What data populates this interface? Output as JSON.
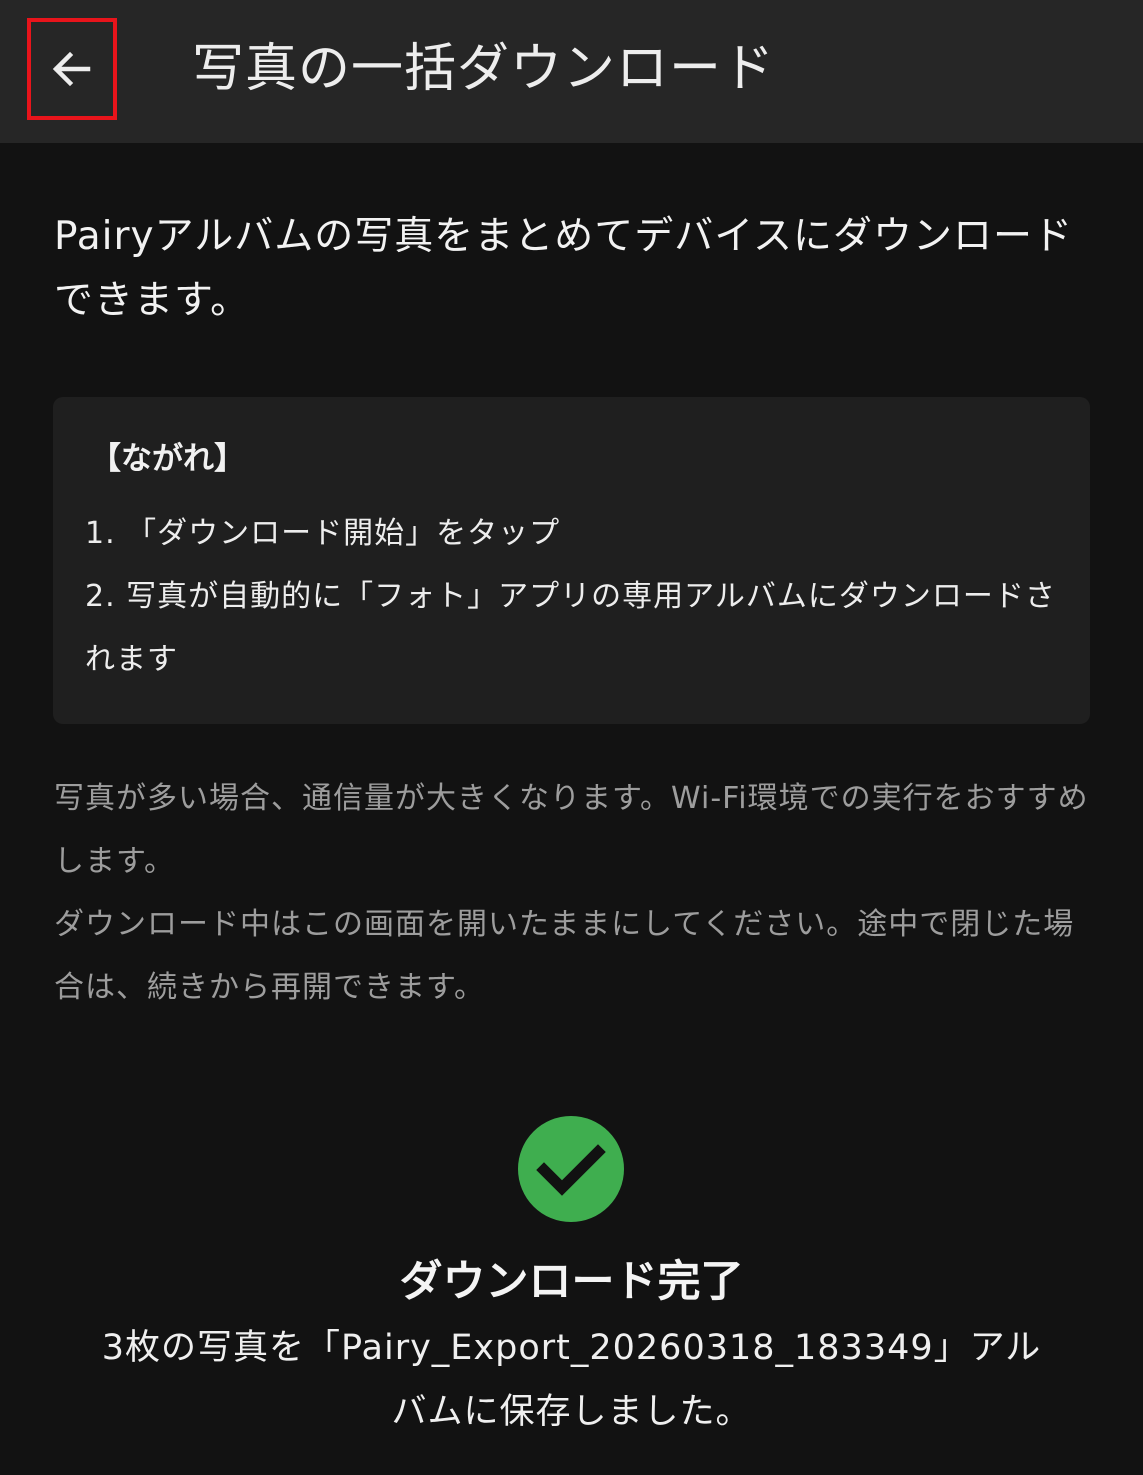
{
  "header": {
    "back_icon": "arrow-left-icon",
    "title": "写真の一括ダウンロード",
    "highlight_color": "#e8141b"
  },
  "intro": {
    "text": "Pairyアルバムの写真をまとめてデバイスにダウンロードできます。"
  },
  "flow": {
    "title": "【ながれ】",
    "steps": [
      "1. 「ダウンロード開始」をタップ",
      "2. 写真が自動的に「フォト」アプリの専用アルバムにダウンロードされます"
    ]
  },
  "notes": [
    "写真が多い場合、通信量が大きくなります。Wi-Fi環境での実行をおすすめします。",
    "ダウンロード中はこの画面を開いたままにしてください。途中で閉じた場合は、続きから再開できます。"
  ],
  "completion": {
    "icon": "check-circle-icon",
    "icon_color": "#3fae4f",
    "title": "ダウンロード完了",
    "message": "3枚の写真を「Pairy_Export_20260318_183349」アルバムに保存しました。"
  }
}
